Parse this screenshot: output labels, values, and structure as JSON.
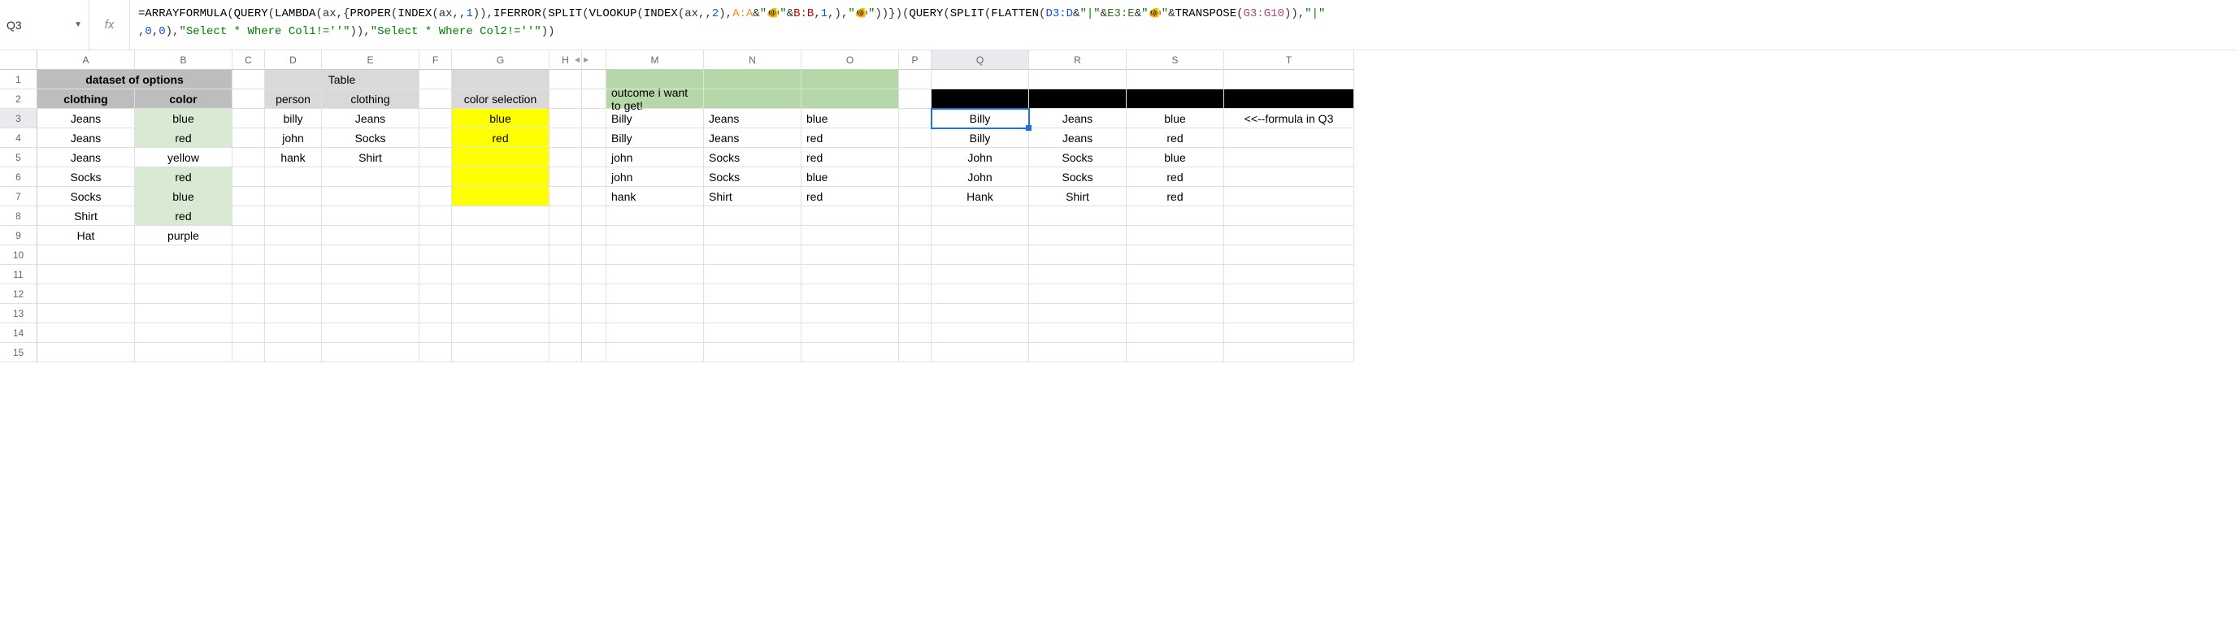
{
  "cell_reference": "Q3",
  "fx_label": "fx",
  "formula_parts": [
    {
      "t": "fn",
      "v": "=ARRAYFORMULA"
    },
    {
      "t": "",
      "v": "("
    },
    {
      "t": "fn",
      "v": "QUERY"
    },
    {
      "t": "",
      "v": "("
    },
    {
      "t": "fn",
      "v": "LAMBDA"
    },
    {
      "t": "",
      "v": "(ax,{"
    },
    {
      "t": "fn",
      "v": "PROPER"
    },
    {
      "t": "",
      "v": "("
    },
    {
      "t": "fn",
      "v": "INDEX"
    },
    {
      "t": "",
      "v": "(ax,,"
    },
    {
      "t": "num",
      "v": "1"
    },
    {
      "t": "",
      "v": ")),"
    },
    {
      "t": "fn",
      "v": "IFERROR"
    },
    {
      "t": "",
      "v": "("
    },
    {
      "t": "fn",
      "v": "SPLIT"
    },
    {
      "t": "",
      "v": "("
    },
    {
      "t": "fn",
      "v": "VLOOKUP"
    },
    {
      "t": "",
      "v": "("
    },
    {
      "t": "fn",
      "v": "INDEX"
    },
    {
      "t": "",
      "v": "(ax,,"
    },
    {
      "t": "num",
      "v": "2"
    },
    {
      "t": "",
      "v": "),"
    },
    {
      "t": "rng-a",
      "v": "A:A"
    },
    {
      "t": "",
      "v": "&"
    },
    {
      "t": "str",
      "v": "\""
    },
    {
      "t": "emoji",
      "v": "🐠"
    },
    {
      "t": "str",
      "v": "\""
    },
    {
      "t": "",
      "v": "&"
    },
    {
      "t": "rng-b",
      "v": "B:B"
    },
    {
      "t": "",
      "v": ","
    },
    {
      "t": "num",
      "v": "1"
    },
    {
      "t": "",
      "v": ",),"
    },
    {
      "t": "str",
      "v": "\""
    },
    {
      "t": "emoji",
      "v": "🐠"
    },
    {
      "t": "str",
      "v": "\""
    },
    {
      "t": "",
      "v": "))})("
    },
    {
      "t": "fn",
      "v": "QUERY"
    },
    {
      "t": "",
      "v": "("
    },
    {
      "t": "fn",
      "v": "SPLIT"
    },
    {
      "t": "",
      "v": "("
    },
    {
      "t": "fn",
      "v": "FLATTEN"
    },
    {
      "t": "",
      "v": "("
    },
    {
      "t": "rng-d",
      "v": "D3:D"
    },
    {
      "t": "",
      "v": "&"
    },
    {
      "t": "str",
      "v": "\"|\""
    },
    {
      "t": "",
      "v": "&"
    },
    {
      "t": "rng-e",
      "v": "E3:E"
    },
    {
      "t": "",
      "v": "&"
    },
    {
      "t": "str",
      "v": "\""
    },
    {
      "t": "emoji",
      "v": "🐠"
    },
    {
      "t": "str",
      "v": "\""
    },
    {
      "t": "",
      "v": "&"
    },
    {
      "t": "fn",
      "v": "TRANSPOSE"
    },
    {
      "t": "",
      "v": "("
    },
    {
      "t": "rng-g",
      "v": "G3:G10"
    },
    {
      "t": "",
      "v": ")),"
    },
    {
      "t": "str",
      "v": "\"|\""
    },
    {
      "t": "",
      "v": "\n,"
    },
    {
      "t": "num",
      "v": "0"
    },
    {
      "t": "",
      "v": ","
    },
    {
      "t": "num",
      "v": "0"
    },
    {
      "t": "",
      "v": "),"
    },
    {
      "t": "str",
      "v": "\"Select * Where Col1!=''\""
    },
    {
      "t": "",
      "v": ")),"
    },
    {
      "t": "str",
      "v": "\"Select * Where Col2!=''\""
    },
    {
      "t": "",
      "v": "))"
    }
  ],
  "columns": [
    "A",
    "B",
    "C",
    "D",
    "E",
    "F",
    "G",
    "H",
    "M",
    "N",
    "O",
    "P",
    "Q",
    "R",
    "S",
    "T"
  ],
  "rows": [
    "1",
    "2",
    "3",
    "4",
    "5",
    "6",
    "7",
    "8",
    "9",
    "10",
    "11",
    "12",
    "13",
    "14",
    "15"
  ],
  "headers": {
    "dataset": "dataset of options",
    "clothing": "clothing",
    "color": "color",
    "table": "Table",
    "person": "person",
    "clothing2": "clothing",
    "color_selection": "color selection",
    "outcome": "outcome i want to get!",
    "formula_note": "<<--formula in Q3"
  },
  "data_ab": [
    [
      "Jeans",
      "blue",
      "lg"
    ],
    [
      "Jeans",
      "red",
      "lg"
    ],
    [
      "Jeans",
      "yellow",
      ""
    ],
    [
      "Socks",
      "red",
      "lg"
    ],
    [
      "Socks",
      "blue",
      "lg"
    ],
    [
      "Shirt",
      "red",
      "lg"
    ],
    [
      "Hat",
      "purple",
      ""
    ]
  ],
  "data_de": [
    [
      "billy",
      "Jeans"
    ],
    [
      "john",
      "Socks"
    ],
    [
      "hank",
      "Shirt"
    ]
  ],
  "data_g": [
    "blue",
    "red",
    "",
    "",
    ""
  ],
  "data_mno": [
    [
      "Billy",
      "Jeans",
      "blue"
    ],
    [
      "Billy",
      "Jeans",
      "red"
    ],
    [
      "john",
      "Socks",
      "red"
    ],
    [
      "john",
      "Socks",
      "blue"
    ],
    [
      "hank",
      "Shirt",
      "red"
    ]
  ],
  "data_qrs": [
    [
      "Billy",
      "Jeans",
      "blue"
    ],
    [
      "Billy",
      "Jeans",
      "red"
    ],
    [
      "John",
      "Socks",
      "blue"
    ],
    [
      "John",
      "Socks",
      "red"
    ],
    [
      "Hank",
      "Shirt",
      "red"
    ]
  ]
}
